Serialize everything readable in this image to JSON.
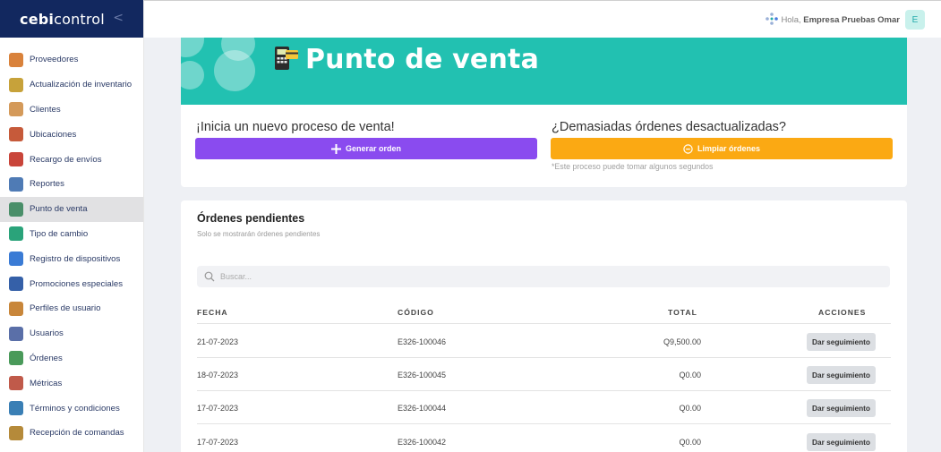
{
  "brand": {
    "logo_prefix": "c",
    "logo_bold": "ebi",
    "logo_rest": "control",
    "collapse_glyph": "<"
  },
  "sidebar": {
    "items": [
      {
        "label": "Proveedores",
        "icon": "truck-icon",
        "color": "#d9823b"
      },
      {
        "label": "Actualización de inventario",
        "icon": "inventory-icon",
        "color": "#c7a23a"
      },
      {
        "label": "Clientes",
        "icon": "clients-icon",
        "color": "#d49a5a"
      },
      {
        "label": "Ubicaciones",
        "icon": "location-icon",
        "color": "#c65a3a"
      },
      {
        "label": "Recargo de envíos",
        "icon": "delivery-icon",
        "color": "#c9453a"
      },
      {
        "label": "Reportes",
        "icon": "reports-icon",
        "color": "#4f7bb5"
      },
      {
        "label": "Punto de venta",
        "icon": "pos-icon",
        "color": "#4a8f6a"
      },
      {
        "label": "Tipo de cambio",
        "icon": "exchange-icon",
        "color": "#2aa37a"
      },
      {
        "label": "Registro de dispositivos",
        "icon": "devices-icon",
        "color": "#3a7bd5"
      },
      {
        "label": "Promociones especiales",
        "icon": "promotions-icon",
        "color": "#3560a8"
      },
      {
        "label": "Perfiles de usuario",
        "icon": "user-profile-icon",
        "color": "#c8863a"
      },
      {
        "label": "Usuarios",
        "icon": "users-icon",
        "color": "#5a6fa8"
      },
      {
        "label": "Órdenes",
        "icon": "orders-icon",
        "color": "#4a9a5a"
      },
      {
        "label": "Métricas",
        "icon": "metrics-icon",
        "color": "#c05a4a"
      },
      {
        "label": "Términos y condiciones",
        "icon": "terms-icon",
        "color": "#3a7fb5"
      },
      {
        "label": "Recepción de comandas",
        "icon": "reception-icon",
        "color": "#b58a3a"
      }
    ],
    "active_index": 6
  },
  "topbar": {
    "greeting": "Hola,",
    "user_name": "Empresa Pruebas Omar",
    "avatar_letter": "E"
  },
  "banner": {
    "title": "Punto de venta",
    "bg_color": "#22c1b1"
  },
  "new_sale": {
    "heading": "¡Inicia un nuevo proceso de venta!",
    "button_label": "Generar orden",
    "button_color": "#8a4bef"
  },
  "outdated": {
    "heading": "¿Demasiadas órdenes desactualizadas?",
    "button_label": "Limpiar órdenes",
    "button_color": "#fba913",
    "note": "*Este proceso puede tomar algunos segundos"
  },
  "pending": {
    "title": "Órdenes pendientes",
    "subtitle": "Solo se mostrarán órdenes pendientes",
    "search_placeholder": "Buscar...",
    "columns": {
      "date": "FECHA",
      "code": "CÓDIGO",
      "total": "TOTAL",
      "actions": "ACCIONES"
    },
    "rows": [
      {
        "date": "21-07-2023",
        "code": "E326-100046",
        "total": "Q9,500.00",
        "action": "Dar seguimiento"
      },
      {
        "date": "18-07-2023",
        "code": "E326-100045",
        "total": "Q0.00",
        "action": "Dar seguimiento"
      },
      {
        "date": "17-07-2023",
        "code": "E326-100044",
        "total": "Q0.00",
        "action": "Dar seguimiento"
      },
      {
        "date": "17-07-2023",
        "code": "E326-100042",
        "total": "Q0.00",
        "action": "Dar seguimiento"
      }
    ]
  }
}
